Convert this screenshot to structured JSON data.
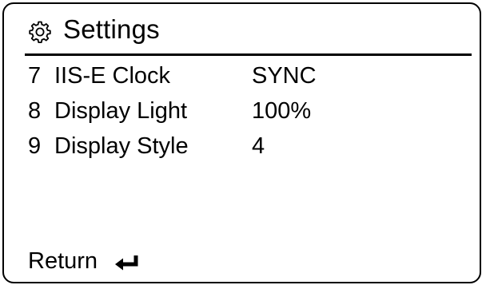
{
  "header": {
    "icon": "gear-icon",
    "title": "Settings"
  },
  "settings": {
    "items": [
      {
        "number": "7",
        "label": "IIS-E Clock",
        "value": "SYNC"
      },
      {
        "number": "8",
        "label": "Display Light",
        "value": "100%"
      },
      {
        "number": "9",
        "label": "Display Style",
        "value": "4"
      }
    ]
  },
  "footer": {
    "return_label": "Return",
    "return_icon": "return-arrow-icon"
  },
  "colors": {
    "foreground": "#000000",
    "background": "#ffffff"
  }
}
